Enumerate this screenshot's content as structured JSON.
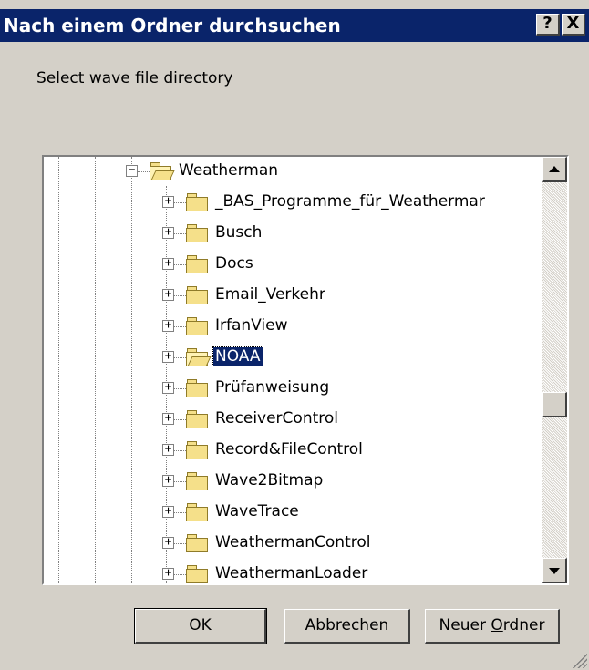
{
  "window": {
    "title": "Nach einem Ordner durchsuchen",
    "help_label": "?",
    "close_label": "X"
  },
  "prompt": "Select wave file directory",
  "tree": {
    "parent": {
      "label": "Weatherman",
      "expander": "−"
    },
    "items": [
      {
        "label": "_BAS_Programme_für_Weathermar",
        "expander": "+"
      },
      {
        "label": "Busch",
        "expander": "+"
      },
      {
        "label": "Docs",
        "expander": "+"
      },
      {
        "label": "Email_Verkehr",
        "expander": "+"
      },
      {
        "label": "IrfanView",
        "expander": "+"
      },
      {
        "label": "NOAA",
        "expander": "+",
        "selected": true
      },
      {
        "label": "Prüfanweisung",
        "expander": "+"
      },
      {
        "label": "ReceiverControl",
        "expander": "+"
      },
      {
        "label": "Record&FileControl",
        "expander": "+"
      },
      {
        "label": "Wave2Bitmap",
        "expander": "+"
      },
      {
        "label": "WaveTrace",
        "expander": "+"
      },
      {
        "label": "WeathermanControl",
        "expander": "+"
      },
      {
        "label": "WeathermanLoader",
        "expander": "+"
      }
    ]
  },
  "buttons": {
    "ok": "OK",
    "cancel": "Abbrechen",
    "new_folder": "Neuer Ordner"
  },
  "colors": {
    "titlebar": "#0a246a",
    "face": "#d4d0c8",
    "selection": "#0a246a"
  }
}
